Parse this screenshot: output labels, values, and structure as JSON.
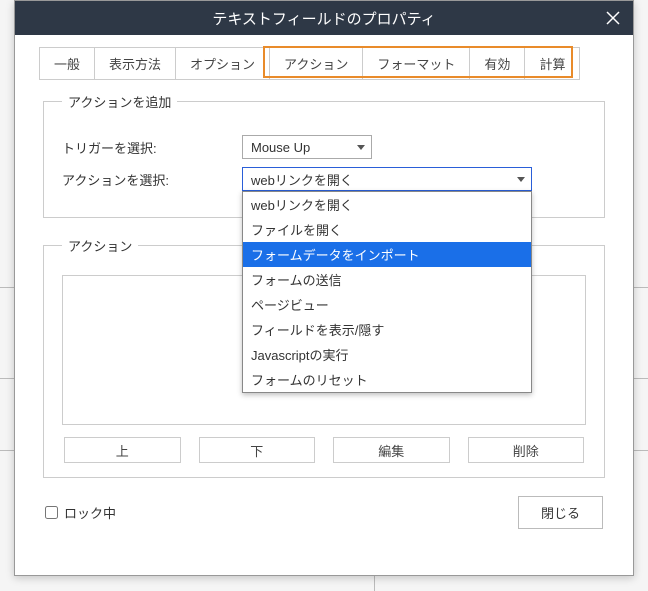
{
  "title": "テキストフィールドのプロパティ",
  "tabs": {
    "general": "一般",
    "appearance": "表示方法",
    "options": "オプション",
    "actions": "アクション",
    "format": "フォーマット",
    "validate": "有効",
    "calculate": "計算"
  },
  "add_action": {
    "legend": "アクションを追加",
    "trigger_label": "トリガーを選択:",
    "trigger_value": "Mouse Up",
    "action_label": "アクションを選択:",
    "action_value": "webリンクを開く",
    "options": {
      "open_web": "webリンクを開く",
      "open_file": "ファイルを開く",
      "import_form": "フォームデータをインポート",
      "submit_form": "フォームの送信",
      "page_view": "ページビュー",
      "show_hide": "フィールドを表示/隠す",
      "run_js": "Javascriptの実行",
      "reset_form": "フォームのリセット"
    }
  },
  "actions_group": {
    "legend": "アクション",
    "btn_up": "上",
    "btn_down": "下",
    "btn_edit": "編集",
    "btn_delete": "削除"
  },
  "footer": {
    "lock": "ロック中",
    "close": "閉じる"
  }
}
